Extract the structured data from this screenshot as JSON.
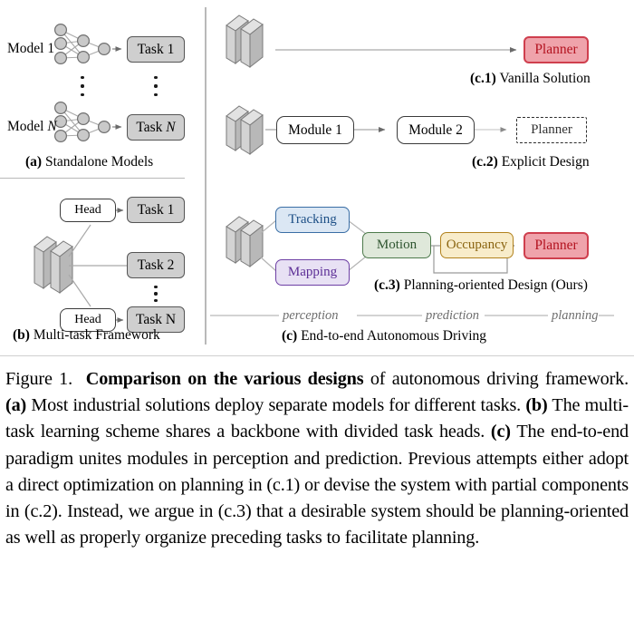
{
  "figure": {
    "panel_a": {
      "caption_prefix": "(a)",
      "caption_text": "Standalone Models",
      "rows": [
        {
          "model_label_prefix": "Model",
          "model_label_index": "1",
          "task_label_prefix": "Task",
          "task_label_index": "1"
        },
        {
          "model_label_prefix": "Model",
          "model_label_index": "N",
          "task_label_prefix": "Task",
          "task_label_index": "N"
        }
      ],
      "network": {
        "input_nodes": 3,
        "hidden_nodes": 2,
        "output_nodes": 1,
        "node_fill": "#c9c9c9",
        "node_stroke": "#6f6f6f"
      }
    },
    "panel_b": {
      "caption_prefix": "(b)",
      "caption_text": "Multi-task Framework",
      "head_label": "Head",
      "branches": [
        {
          "head": "Head",
          "task": "Task 1"
        },
        {
          "head": "",
          "task": "Task 2"
        },
        {
          "head": "Head",
          "task": "Task N"
        }
      ]
    },
    "panel_c": {
      "caption_prefix": "(c)",
      "caption_text": "End-to-end Autonomous Driving",
      "stages": [
        "perception",
        "prediction",
        "planning"
      ],
      "c1": {
        "caption_prefix": "(c.1)",
        "caption_text": "Vanilla Solution",
        "nodes": [
          "Planner"
        ]
      },
      "c2": {
        "caption_prefix": "(c.2)",
        "caption_text": "Explicit Design",
        "nodes": [
          "Module 1",
          "Module 2",
          "Planner"
        ]
      },
      "c3": {
        "caption_prefix": "(c.3)",
        "caption_text": "Planning-oriented Design (Ours)",
        "nodes": [
          "Tracking",
          "Mapping",
          "Motion",
          "Occupancy",
          "Planner"
        ]
      }
    },
    "colors": {
      "planner_fill": "#efa3ab",
      "planner_border": "#cf3f4e",
      "tracking_fill": "#dbe7f4",
      "tracking_border": "#3a6ea5",
      "mapping_fill": "#e8e1f4",
      "mapping_border": "#6e40a5",
      "motion_fill": "#dfe8da",
      "motion_border": "#4d7a4b",
      "occupancy_fill": "#f8ecca",
      "occupancy_border": "#b2821e",
      "task_fill": "#cfcfcf",
      "divider": "#b9b9b9"
    }
  },
  "caption": {
    "label": "Figure 1.",
    "bold_title": "Comparison on the various designs",
    "body_1": " of autonomous driving framework. ",
    "a_tag": "(a)",
    "body_2": " Most industrial solutions deploy separate models for different tasks. ",
    "b_tag": "(b)",
    "body_3": " The multi-task learning scheme shares a backbone with divided task heads. ",
    "c_tag": "(c)",
    "body_4": " The end-to-end paradigm unites modules in perception and prediction. Previous attempts either adopt a direct optimization on planning in (c.1) or devise the system with partial components in (c.2). Instead, we argue in (c.3) that a desirable system should be planning-oriented as well as properly organize preceding tasks to facilitate planning."
  }
}
